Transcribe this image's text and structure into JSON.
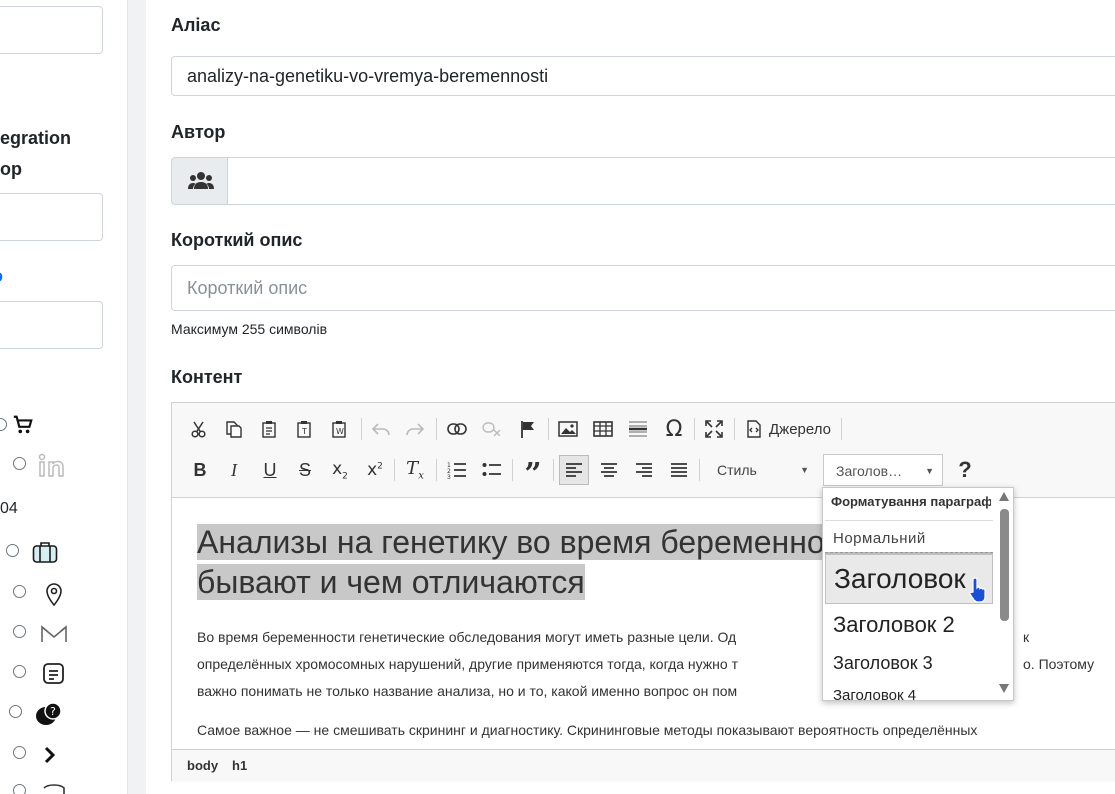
{
  "sidebar": {
    "text_integration": "egration",
    "text_op": "op",
    "text_o": "o",
    "text_04": "04"
  },
  "form": {
    "alias_label": "Аліас",
    "alias_value": "analizy-na-genetiku-vo-vremya-beremennosti",
    "author_label": "Автор",
    "author_value": "",
    "short_desc_label": "Короткий опис",
    "short_desc_placeholder": "Короткий опис",
    "short_desc_hint": "Максимум 255 символів",
    "content_label": "Контент"
  },
  "editor": {
    "source_label": "Джерело",
    "style_combo": "Стиль",
    "format_combo": "Заголов…",
    "help_label": "?",
    "heading_line1": "Анализы на генетику во время беременно",
    "heading_line2": "бывают и чем отличаются",
    "para1_line1": "Во время беременности генетические обследования могут иметь разные цели. Од",
    "para1_line1_tail": "к",
    "para1_line2": "определённых хромосомных нарушений, другие применяются тогда, когда нужно т",
    "para1_line2_tail": "о. Поэтому",
    "para1_line3": "важно понимать не только название анализа, но и то, какой именно вопрос он пом",
    "para2": "Самое важное — не смешивать скрининг и диагностику. Скрининговые методы показывают вероятность определённых",
    "status_body": "body",
    "status_h1": "h1"
  },
  "format_dropdown": {
    "title": "Форматування параграфа",
    "items": [
      "Нормальний",
      "Заголовок",
      "Заголовок 2",
      "Заголовок 3",
      "Заголовок 4"
    ],
    "selected_index": 1
  },
  "colors": {
    "border": "#ced4da",
    "selection": "#c8c8c8",
    "toolbar_bg": "#f8f8f8"
  }
}
